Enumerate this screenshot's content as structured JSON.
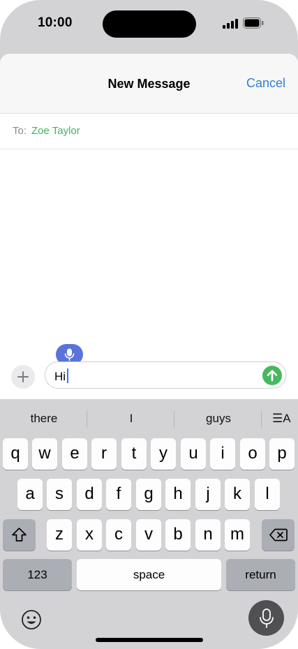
{
  "status_bar": {
    "time": "10:00",
    "signal_icon": "cellular-signal-icon",
    "battery_icon": "battery-full-icon"
  },
  "header": {
    "title": "New Message",
    "cancel_label": "Cancel",
    "accent_color": "#2f80d8"
  },
  "recipient": {
    "to_label": "To:",
    "name": "Zoe Taylor",
    "name_color": "#3cb55f"
  },
  "compose": {
    "text": "Hi",
    "plus_icon": "plus-icon",
    "dictation_icon": "microphone-icon",
    "send_icon": "arrow-up-icon",
    "send_color": "#48b860"
  },
  "keyboard": {
    "suggestions": [
      "there",
      "I",
      "guys"
    ],
    "format_icon_label": "☰A",
    "row1": [
      "q",
      "w",
      "e",
      "r",
      "t",
      "y",
      "u",
      "i",
      "o",
      "p"
    ],
    "row2": [
      "a",
      "s",
      "d",
      "f",
      "g",
      "h",
      "j",
      "k",
      "l"
    ],
    "row3": [
      "z",
      "x",
      "c",
      "v",
      "b",
      "n",
      "m"
    ],
    "numbers_label": "123",
    "space_label": "space",
    "return_label": "return",
    "shift_icon": "shift-icon",
    "delete_icon": "delete-icon",
    "emoji_icon": "emoji-icon",
    "mic_icon": "microphone-icon"
  }
}
